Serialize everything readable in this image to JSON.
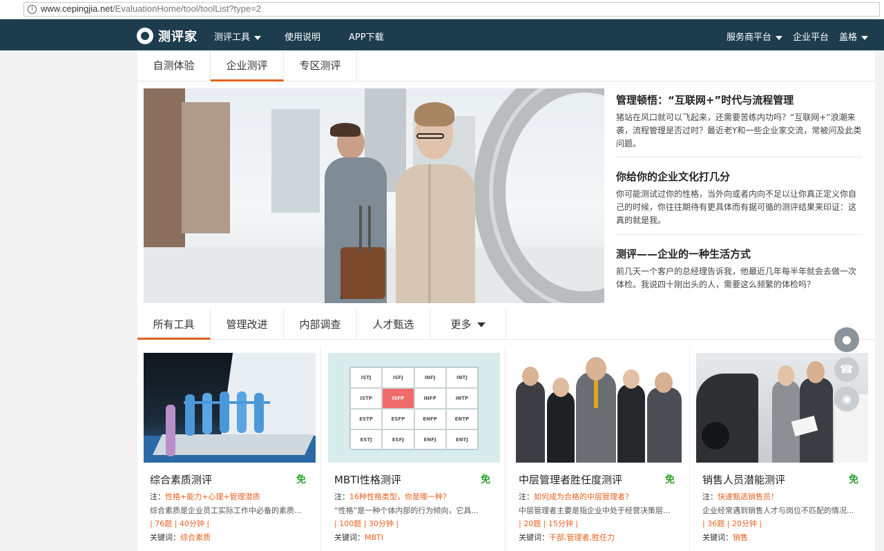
{
  "browser": {
    "url_host": "www.cepingjia.net",
    "url_path": "/EvaluationHome/tool/toolList?type=2"
  },
  "nav": {
    "logo": "测评家",
    "items": [
      "测评工具",
      "使用说明",
      "APP下载"
    ],
    "right_items": [
      "服务商平台",
      "企业平台",
      "盖格"
    ]
  },
  "category_tabs": [
    "自测体验",
    "企业测评",
    "专区测评"
  ],
  "articles": [
    {
      "title": "管理顿悟：“互联网+”时代与流程管理",
      "body": "猪站在风口就可以飞起来，还需要苦练内功吗？“互联网+”浪潮来袭，流程管理是否过时？最近老Y和一些企业家交流，常被问及此类问题。"
    },
    {
      "title": "你给你的企业文化打几分",
      "body": "你可能测试过你的性格，当外向或者内向不足以让你真正定义你自己的时候，你往往期待有更具体而有据可循的测评结果来印证：这真的就是我。"
    },
    {
      "title": "测评——企业的一种生活方式",
      "body": "前几天一个客户的总经理告诉我，他最近几年每半年就会去做一次体检。我说四十刚出头的人，需要这么频繁的体检吗？"
    }
  ],
  "tool_tabs": [
    "所有工具",
    "管理改进",
    "内部调查",
    "人才甄选",
    "更多"
  ],
  "mbti_types": [
    "ISTJ",
    "ISFJ",
    "INFJ",
    "INTJ",
    "ISTP",
    "ISFP",
    "INFP",
    "INTP",
    "ESTP",
    "ESFP",
    "ENFP",
    "ENTP",
    "ESTJ",
    "ESFJ",
    "ENFJ",
    "ENTJ"
  ],
  "cards": [
    {
      "title": "综合素质测评",
      "free": "免",
      "note_label": "注：",
      "note": "性格+能力+心理+管理潜质",
      "desc": "综合素质是企业员工实际工作中必备的素质...",
      "stat": "| 76题 | 40分钟 |",
      "kw_label": "关键词：",
      "kw": "综合素质"
    },
    {
      "title": "MBTI性格测评",
      "free": "免",
      "note_label": "注：",
      "note": "16种性格类型，你是哪一种？",
      "desc": "“性格”是一种个体内部的行为倾向，它具...",
      "stat": "| 100题 | 30分钟 |",
      "kw_label": "关键词：",
      "kw": "MBTI"
    },
    {
      "title": "中层管理者胜任度测评",
      "free": "免",
      "note_label": "注：",
      "note": "如何成为合格的中层管理者？",
      "desc": "中层管理者主要是指企业中处于经营决策层...",
      "stat": "| 20题 | 15分钟 |",
      "kw_label": "关键词：",
      "kw": "干部,管理者,胜任力"
    },
    {
      "title": "销售人员潜能测评",
      "free": "免",
      "note_label": "注：",
      "note": "快速甄选销售员！",
      "desc": "企业经常遇到销售人才与岗位不匹配的情况...",
      "stat": "| 36题 | 20分钟 |",
      "kw_label": "关键词：",
      "kw": "销售"
    }
  ],
  "colors": {
    "nav_bg": "#1d3d4f",
    "accent": "#e8611f",
    "free": "#2aa02a"
  }
}
